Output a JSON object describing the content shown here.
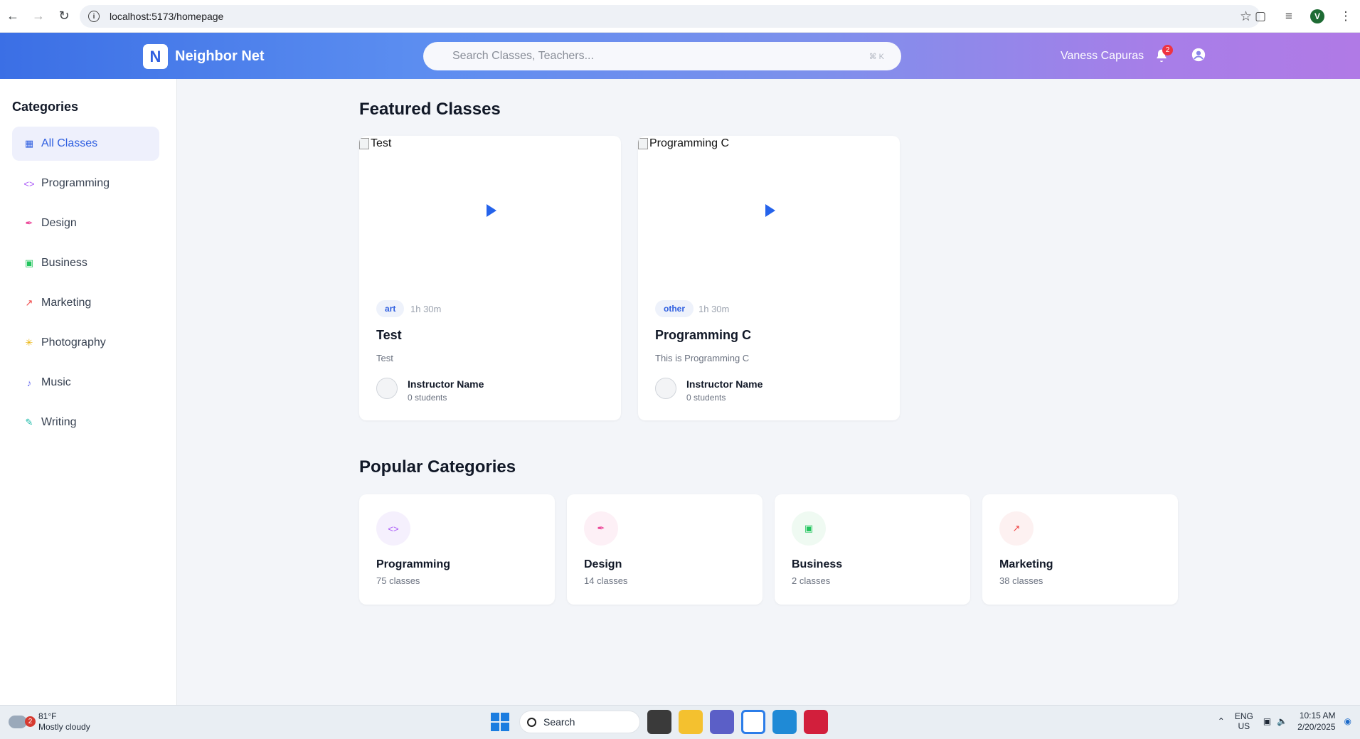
{
  "browser": {
    "url": "localhost:5173/homepage",
    "profile_initial": "V"
  },
  "header": {
    "logo_letter": "N",
    "app_name": "Neighbor Net",
    "search_placeholder": "Search Classes, Teachers...",
    "search_shortcut": "⌘ K",
    "user_name": "Vaness Capuras",
    "notification_count": "2"
  },
  "sidebar": {
    "title": "Categories",
    "items": [
      {
        "label": "All Classes",
        "icon": "grid-icon",
        "color": "#2f5fe0",
        "active": true
      },
      {
        "label": "Programming",
        "icon": "code-icon",
        "color": "#a855f7"
      },
      {
        "label": "Design",
        "icon": "brush-icon",
        "color": "#ec4899"
      },
      {
        "label": "Business",
        "icon": "briefcase-icon",
        "color": "#22c55e"
      },
      {
        "label": "Marketing",
        "icon": "trend-icon",
        "color": "#ef4444"
      },
      {
        "label": "Photography",
        "icon": "camera-icon",
        "color": "#eab308"
      },
      {
        "label": "Music",
        "icon": "music-icon",
        "color": "#6366f1"
      },
      {
        "label": "Writing",
        "icon": "pen-icon",
        "color": "#14b8a6"
      }
    ]
  },
  "featured": {
    "title": "Featured Classes",
    "classes": [
      {
        "image_alt": "Test",
        "tag": "art",
        "duration": "1h 30m",
        "title": "Test",
        "description": "Test",
        "instructor": "Instructor Name",
        "students": "0 students"
      },
      {
        "image_alt": "Programming C",
        "tag": "other",
        "duration": "1h 30m",
        "title": "Programming C",
        "description": "This is Programming C",
        "instructor": "Instructor Name",
        "students": "0 students"
      }
    ]
  },
  "popular": {
    "title": "Popular Categories",
    "categories": [
      {
        "name": "Programming",
        "count": "75 classes",
        "icon": "code-icon",
        "color": "#a855f7",
        "bg": "#f5f0fd"
      },
      {
        "name": "Design",
        "count": "14 classes",
        "icon": "brush-icon",
        "color": "#ec4899",
        "bg": "#fdf0f6"
      },
      {
        "name": "Business",
        "count": "2 classes",
        "icon": "briefcase-icon",
        "color": "#22c55e",
        "bg": "#effaf2"
      },
      {
        "name": "Marketing",
        "count": "38 classes",
        "icon": "trend-icon",
        "color": "#ef4444",
        "bg": "#fdf1f1"
      }
    ]
  },
  "taskbar": {
    "weather_badge": "2",
    "temperature": "81°F",
    "weather_desc": "Mostly cloudy",
    "search_label": "Search",
    "lang_top": "ENG",
    "lang_bottom": "US",
    "time": "10:15 AM",
    "date": "2/20/2025"
  }
}
